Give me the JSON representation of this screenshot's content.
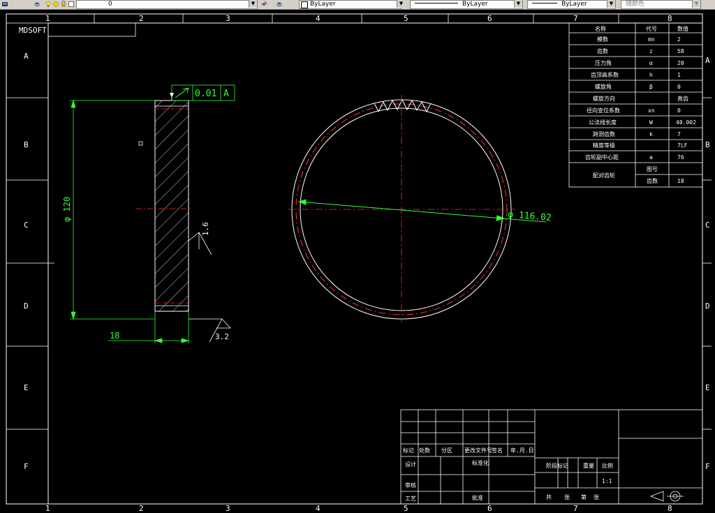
{
  "toolbar": {
    "layer_value": "0",
    "color_value": "ByLayer",
    "linetype_value": "ByLayer",
    "lineweight_value": "ByLayer",
    "plotstyle_value": "随颜色"
  },
  "border": {
    "col_numbers": [
      "1",
      "2",
      "3",
      "4",
      "5",
      "6",
      "7",
      "8"
    ],
    "row_letters": [
      "A",
      "B",
      "C",
      "D",
      "E",
      "F"
    ],
    "corner_label": "MDSOFT"
  },
  "side_view": {
    "diameter_dim": "φ 120",
    "width_dim": "18",
    "tolerance_value": "0.01",
    "datum_label": "A",
    "roughness_side": "1.6",
    "roughness_bottom": "3.2"
  },
  "front_view": {
    "diameter_dim": "φ 116.02"
  },
  "param_table": {
    "header": [
      "名称",
      "代号",
      "数值"
    ],
    "rows": [
      [
        "模数",
        "mn",
        "2"
      ],
      [
        "齿数",
        "z",
        "58"
      ],
      [
        "压力角",
        "α",
        "20"
      ],
      [
        "齿顶高系数",
        "h",
        "1"
      ],
      [
        "螺旋角",
        "β",
        "0"
      ],
      [
        "螺旋方向",
        "",
        "直齿"
      ],
      [
        "径向变位系数",
        "xn",
        "0"
      ],
      [
        "公法线长度",
        "W",
        "40.002"
      ],
      [
        "跨测齿数",
        "k",
        "7"
      ],
      [
        "精度等级",
        "",
        "7LF"
      ],
      [
        "齿轮副中心距",
        "a",
        "76"
      ]
    ],
    "last_row": {
      "label": "配对齿轮",
      "sub1": "图号",
      "sub1_value": "",
      "sub2": "齿数",
      "sub2_value": "18"
    }
  },
  "title_block": {
    "rev_headers": [
      "标记",
      "处数",
      "分区",
      "更改文件号",
      "签名",
      "年.月.日"
    ],
    "design_label": "设计",
    "standard_label": "标准化",
    "check_label": "审核",
    "process_label": "工艺",
    "approve_label": "批准",
    "stage_label": "阶段标记",
    "weight_label": "重量",
    "scale_label": "比例",
    "scale_value": "1:1",
    "total_label": "共",
    "sheet_label": "张",
    "page_label": "第",
    "page_sheet_label": "张"
  }
}
